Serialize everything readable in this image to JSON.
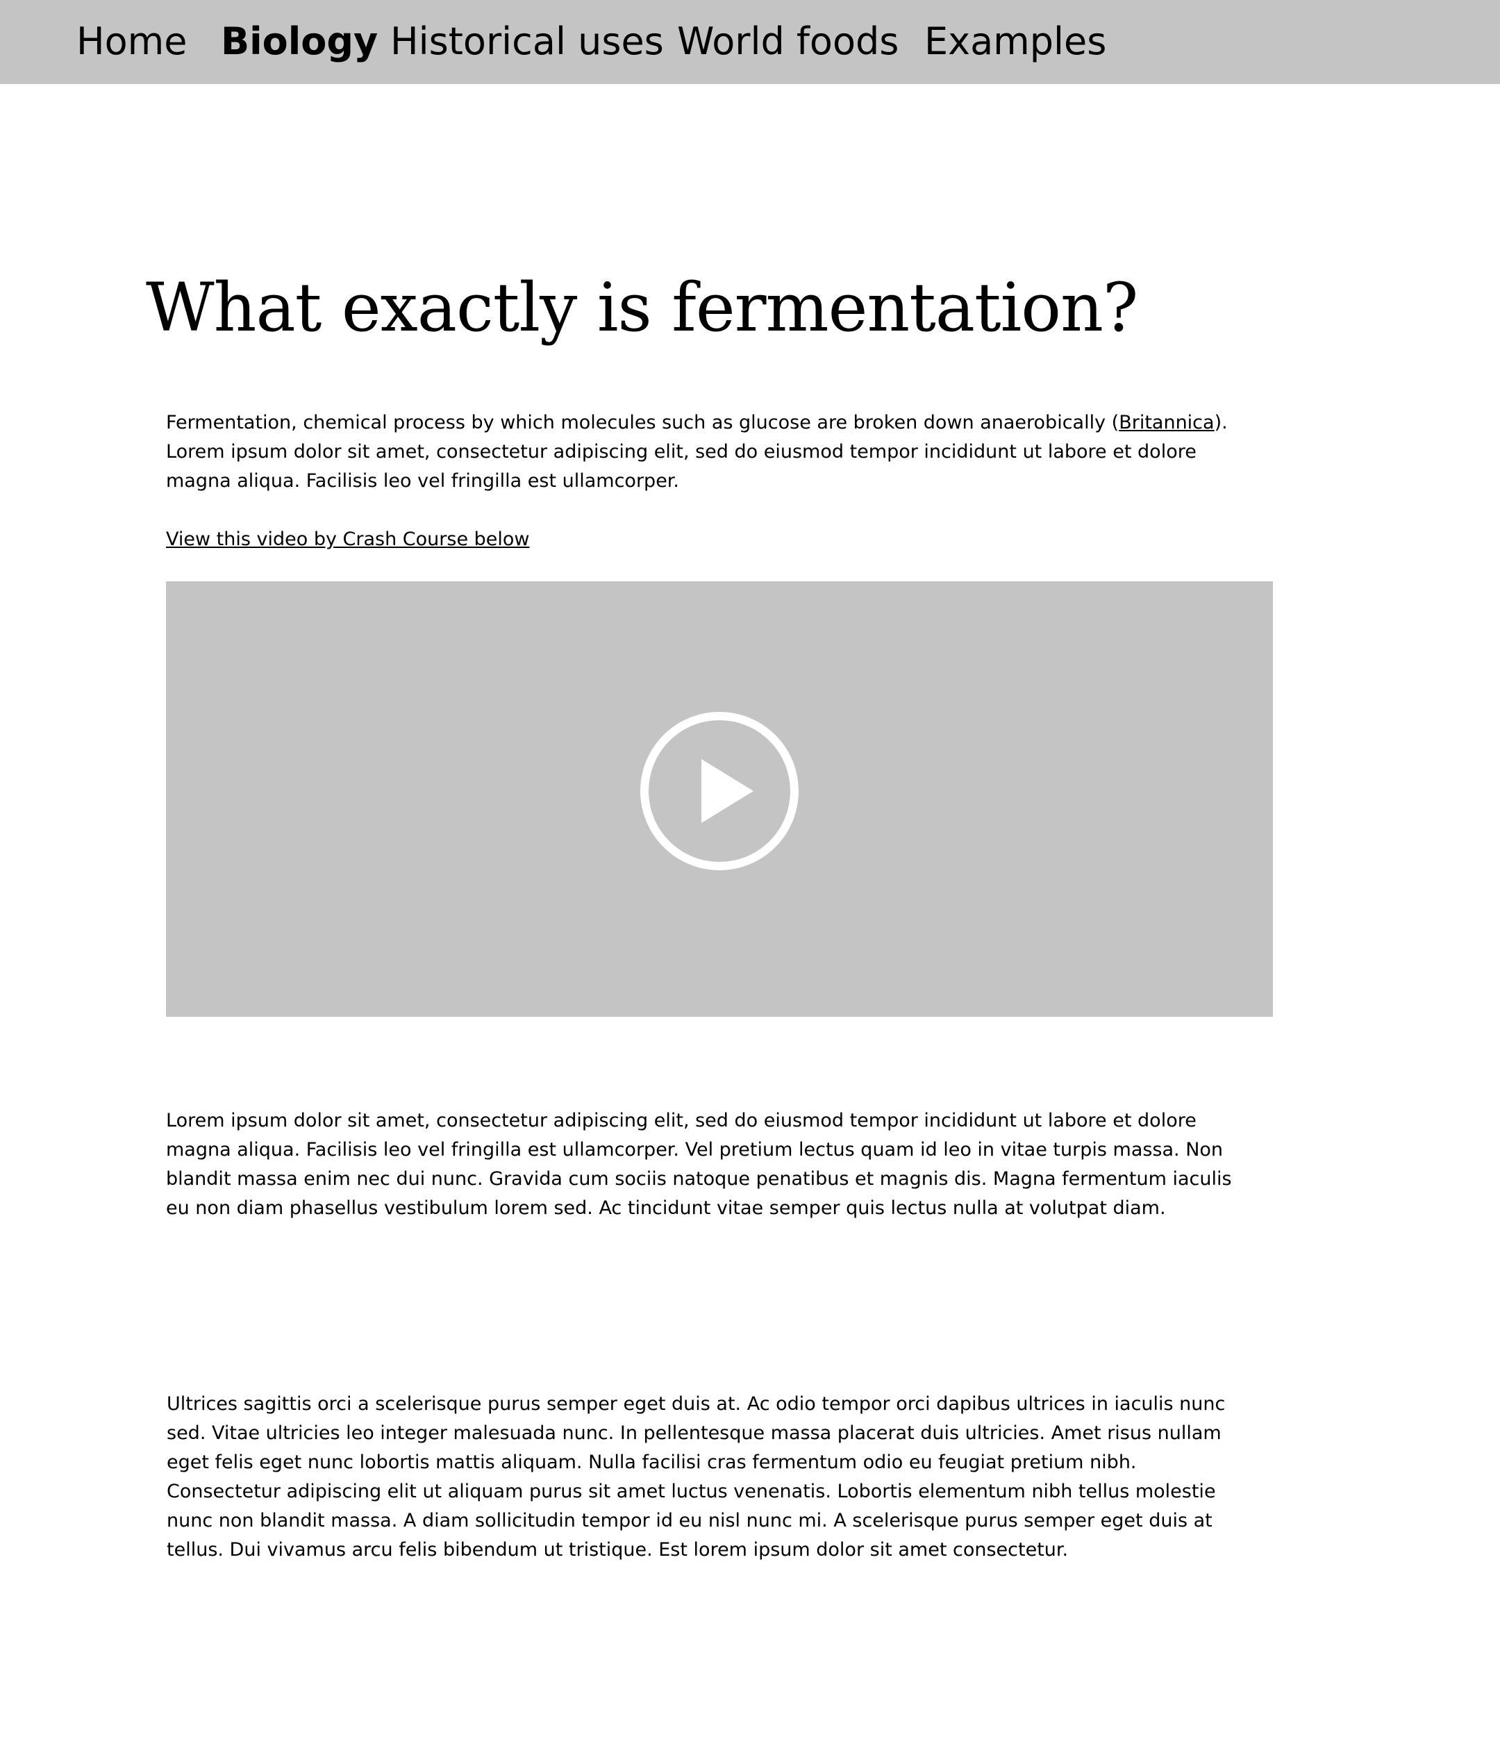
{
  "nav": {
    "items": [
      {
        "label": "Home",
        "active": false
      },
      {
        "label": "Biology",
        "active": true
      },
      {
        "label": "Historical uses",
        "active": false
      },
      {
        "label": "World foods",
        "active": false
      },
      {
        "label": "Examples",
        "active": false
      }
    ]
  },
  "colors": {
    "nav_background": "#c4c4c4",
    "video_background": "#c4c4c4",
    "play_icon": "#ffffff",
    "text": "#000000",
    "page_background": "#ffffff"
  },
  "main": {
    "title": "What exactly is fermentation?",
    "intro": {
      "before_link": "Fermentation, chemical process by which molecules such as glucose are broken down anaerobically (",
      "link_text": "Britannica",
      "after_link": "). Lorem ipsum dolor sit amet, consectetur adipiscing elit, sed do eiusmod tempor incididunt ut labore et dolore magna aliqua. Facilisis leo vel fringilla est ullamcorper."
    },
    "video_link": "View this video by Crash Course below",
    "video": {
      "icon": "play-icon"
    },
    "paragraph_2": "Lorem ipsum dolor sit amet, consectetur adipiscing elit, sed do eiusmod tempor incididunt ut labore et dolore magna aliqua. Facilisis leo vel fringilla est ullamcorper. Vel pretium lectus quam id leo in vitae turpis massa. Non blandit massa enim nec dui nunc. Gravida cum sociis natoque penatibus et magnis dis. Magna fermentum iaculis eu non diam phasellus vestibulum lorem sed. Ac tincidunt vitae semper quis lectus nulla at volutpat diam.",
    "paragraph_3": "Ultrices sagittis orci a scelerisque purus semper eget duis at. Ac odio tempor orci dapibus ultrices in iaculis nunc sed. Vitae ultricies leo integer malesuada nunc. In pellentesque massa placerat duis ultricies. Amet risus nullam eget felis eget nunc lobortis mattis aliquam. Nulla facilisi cras fermentum odio eu feugiat pretium nibh. Consectetur adipiscing elit ut aliquam purus sit amet luctus venenatis. Lobortis elementum nibh tellus molestie nunc non blandit massa. A diam sollicitudin tempor id eu nisl nunc mi. A scelerisque purus semper eget duis at tellus. Dui vivamus arcu felis bibendum ut tristique. Est lorem ipsum dolor sit amet consectetur."
  }
}
